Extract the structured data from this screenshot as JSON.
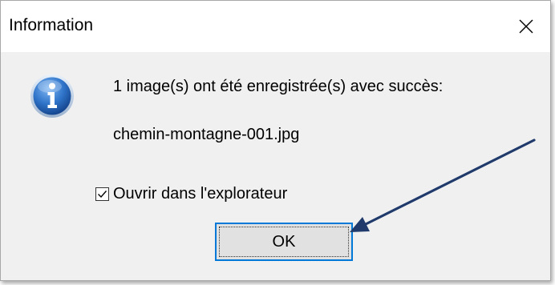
{
  "window": {
    "title": "Information",
    "close_icon": "close-icon"
  },
  "content": {
    "icon": "info-icon",
    "message": "1 image(s) ont été enregistrée(s) avec succès:",
    "filename": "chemin-montagne-001.jpg"
  },
  "checkbox": {
    "label": "Ouvrir dans l'explorateur",
    "checked": true
  },
  "buttons": {
    "ok_label": "OK"
  },
  "colors": {
    "dialog_background": "#f0f0f0",
    "titlebar_background": "#ffffff",
    "button_focus_border": "#0078d7",
    "annotation_arrow": "#1f3a6b"
  }
}
